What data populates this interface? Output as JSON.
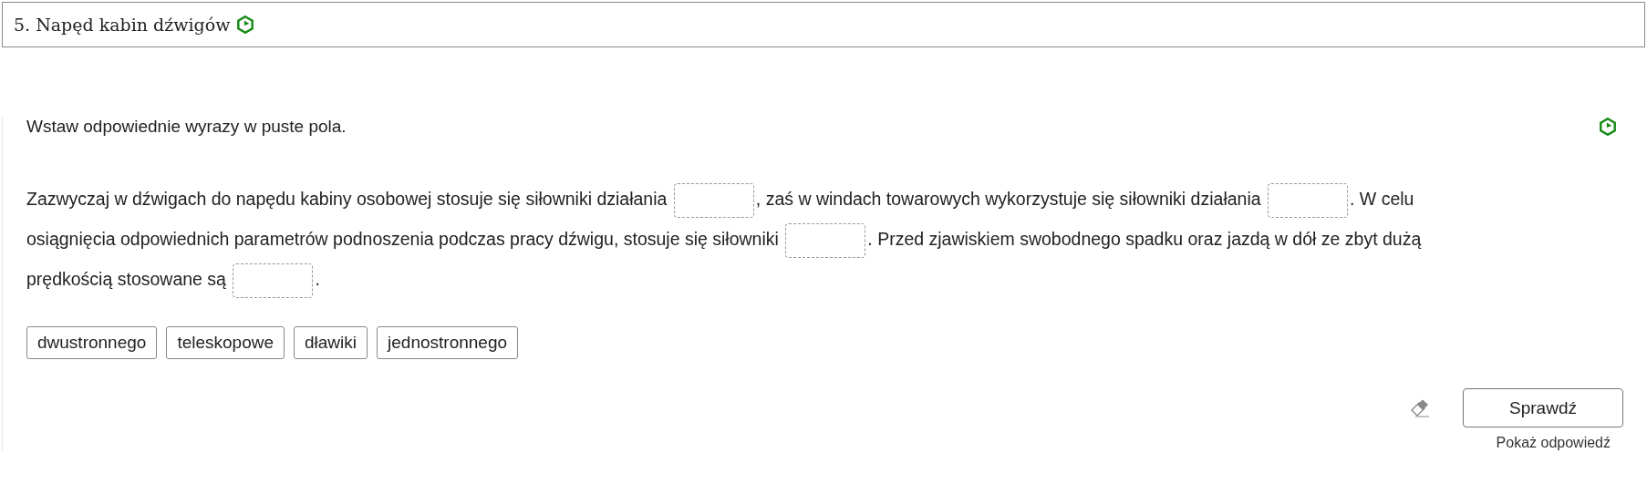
{
  "header": {
    "title": "5. Napęd kabin dźwigów"
  },
  "instruction": "Wstaw odpowiednie wyrazy w puste pola.",
  "paragraph": [
    {
      "kind": "text",
      "text": "Zazwyczaj w dźwigach do napędu kabiny osobowej stosuje się siłowniki działania"
    },
    {
      "kind": "blank"
    },
    {
      "kind": "text",
      "text": ", zaś w windach towarowych wykorzystuje się siłowniki działania"
    },
    {
      "kind": "blank"
    },
    {
      "kind": "text",
      "text": ". W celu"
    },
    {
      "kind": "text",
      "text": "osiągnięcia odpowiednich parametrów podnoszenia podczas pracy dźwigu, stosuje się siłowniki"
    },
    {
      "kind": "blank"
    },
    {
      "kind": "text",
      "text": ". Przed zjawiskiem swobodnego spadku oraz jazdą w dół ze zbyt dużą"
    },
    {
      "kind": "text",
      "text": "prędkością stosowane są"
    },
    {
      "kind": "blank"
    },
    {
      "kind": "text",
      "text": "."
    }
  ],
  "word_bank": [
    "dwustronnego",
    "teleskopowe",
    "dławiki",
    "jednostronnego"
  ],
  "check_button": "Sprawdź",
  "show_answer_link": "Pokaż odpowiedź"
}
